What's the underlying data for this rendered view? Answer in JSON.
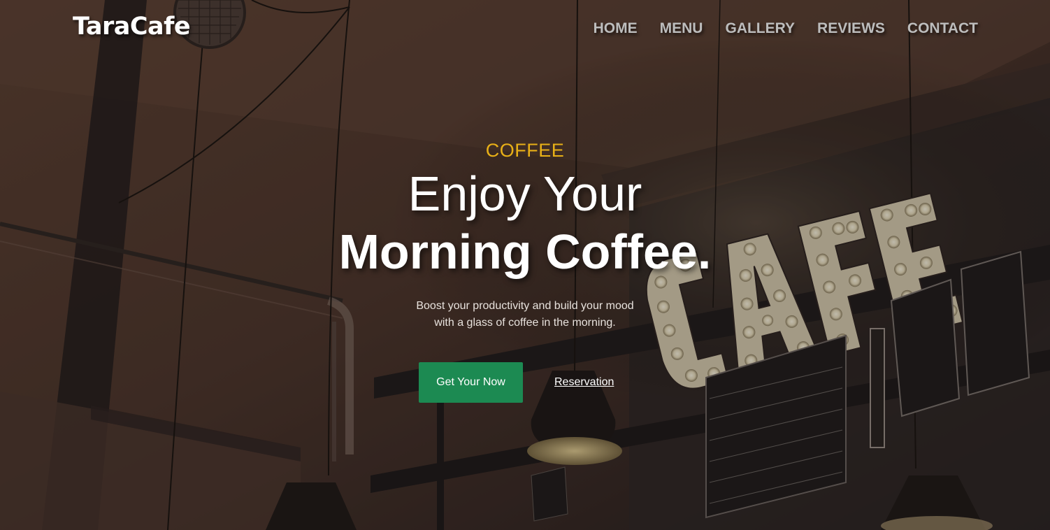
{
  "brand": {
    "name": "TaraCafe"
  },
  "nav": {
    "items": [
      {
        "label": "HOME"
      },
      {
        "label": "MENU"
      },
      {
        "label": "GALLERY"
      },
      {
        "label": "REVIEWS"
      },
      {
        "label": "CONTACT"
      }
    ]
  },
  "hero": {
    "eyebrow": "COFFEE",
    "headline_line1": "Enjoy Your",
    "headline_line2": "Morning Coffee.",
    "description": "Boost your productivity and build your mood with a glass of coffee in the morning.",
    "primary_button": "Get Your Now",
    "secondary_link": "Reservation",
    "background_sign": "CAFE"
  },
  "colors": {
    "accent": "#e8b017",
    "button": "#1c8a52",
    "nav_text": "#bdbdbd",
    "overlay": "#3a2a24"
  }
}
